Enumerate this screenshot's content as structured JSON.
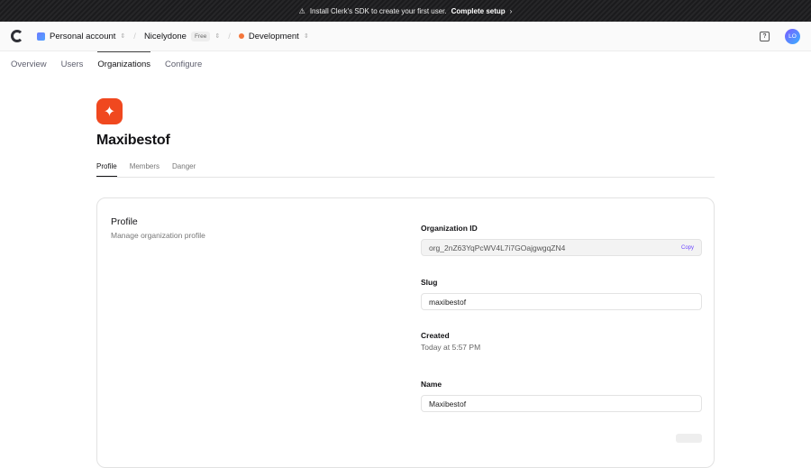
{
  "banner": {
    "text": "Install Clerk's SDK to create your first user.",
    "link": "Complete setup"
  },
  "topbar": {
    "account": "Personal account",
    "app": "Nicelydone",
    "plan": "Free",
    "env": "Development",
    "avatar": "LO"
  },
  "nav": [
    "Overview",
    "Users",
    "Organizations",
    "Configure"
  ],
  "org": {
    "name": "Maxibestof",
    "tabs": [
      "Profile",
      "Members",
      "Danger"
    ]
  },
  "card": {
    "title": "Profile",
    "subtitle": "Manage organization profile",
    "org_id_label": "Organization ID",
    "org_id": "org_2nZ63YqPcWV4L7i7GOajgwgqZN4",
    "copy": "Copy",
    "slug_label": "Slug",
    "slug": "maxibestof",
    "created_label": "Created",
    "created": "Today at 5:57 PM",
    "name_label": "Name",
    "name": "Maxibestof"
  },
  "colors": {
    "brand": "#f0481f",
    "accent": "#6c47ff"
  }
}
